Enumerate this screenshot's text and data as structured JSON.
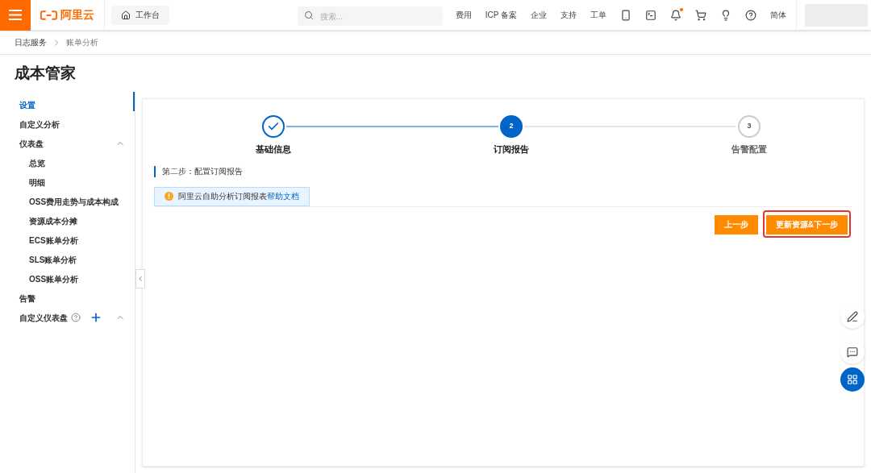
{
  "top_bar": {
    "logo": "阿里云",
    "workbench": "工作台",
    "search": {
      "placeholder": "搜索..."
    },
    "links": [
      "费用",
      "ICP 备案",
      "企业",
      "支持",
      "工单"
    ],
    "notification_dot": true,
    "language": "简体"
  },
  "breadcrumb": [
    "日志服务",
    "账单分析"
  ],
  "page_title": "成本管家",
  "sidebar": {
    "items": [
      {
        "label": "设置",
        "selected": true
      },
      {
        "label": "自定义分析",
        "selected": false
      },
      {
        "label": "仪表盘",
        "selected": false,
        "expanded": true,
        "children": [
          {
            "label": "总览",
            "selected": false
          },
          {
            "label": "明细",
            "selected": false
          },
          {
            "label": "OSS费用走势与成本构成",
            "selected": false
          },
          {
            "label": "资源成本分摊",
            "selected": false
          },
          {
            "label": "ECS账单分析",
            "selected": false
          },
          {
            "label": "SLS账单分析",
            "selected": false
          },
          {
            "label": "OSS账单分析",
            "selected": false
          }
        ]
      },
      {
        "label": "告警",
        "selected": false
      },
      {
        "label": "自定义仪表盘",
        "selected": false,
        "expanded": true,
        "help": true,
        "add": true
      }
    ]
  },
  "steps": [
    {
      "label": "基础信息",
      "done": true,
      "selected": false
    },
    {
      "number": "2",
      "label": "订阅报告",
      "done": false,
      "selected": true
    },
    {
      "number": "3",
      "label": "告警配置",
      "done": false,
      "selected": false
    }
  ],
  "section_title": "第二步：配置订阅报告",
  "notice": {
    "text": "阿里云自助分析订阅报表",
    "link": "帮助文档"
  },
  "buttons": [
    {
      "label": "上一步",
      "highlighted": false
    },
    {
      "label": "更新资源&下一步",
      "highlighted": true
    }
  ]
}
